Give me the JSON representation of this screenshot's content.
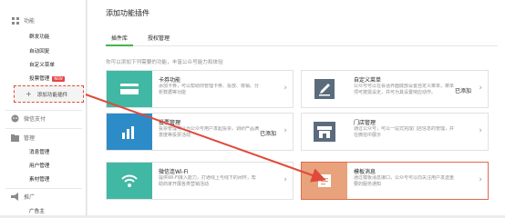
{
  "sidebar": {
    "sections": [
      {
        "label": "功能",
        "icon": "grid-icon"
      },
      {
        "label": "微信支付",
        "icon": "wechat-pay-icon"
      },
      {
        "label": "管理",
        "icon": "folder-icon"
      },
      {
        "label": "推广",
        "icon": "promote-icon"
      }
    ],
    "function_items": [
      "群发功能",
      "自动回复",
      "自定义菜单",
      "投票管理"
    ],
    "new_badge": "NEW",
    "add_plugin_label": "添加功能插件",
    "manage_items": [
      "消息管理",
      "用户管理",
      "素材管理"
    ],
    "promote_items": [
      "广告主"
    ]
  },
  "main": {
    "title": "添加功能插件",
    "tabs": [
      {
        "label": "插件库"
      },
      {
        "label": "授权管理"
      }
    ],
    "intro": "你可以添加下列需要的功能，丰富公众号能力和体验",
    "cards": [
      {
        "title": "卡券功能",
        "desc": "添加卡券，可以帮助你管理卡券、投放、核销、分析数据等功能",
        "status": "",
        "color": "#41b8a4",
        "icon": "card-coupon-icon"
      },
      {
        "title": "自定义菜单",
        "desc": "公众号可以在会话界面底部设置自定义菜单，菜单项可按需设定，并可为其设置响应动作。",
        "status": "已添加",
        "color": "#ffffff",
        "icon": "edit-pen-icon"
      },
      {
        "title": "投票管理",
        "desc": "投票管理可以为公众号用户发起投票，调研产品满意度等投票活动",
        "status": "已添加",
        "color": "#2d8cc8",
        "icon": "bar-chart-icon"
      },
      {
        "title": "门店管理",
        "desc": "通过公众号，可以一站式完成门店信息的管理，并在微信中展示",
        "status": "",
        "color": "#ffffff",
        "icon": "store-icon"
      },
      {
        "title": "微信连Wi-Fi",
        "desc": "提供Wi-Fi接入能力，打通线上与线下的闭环，帮助商家开展各类营销活动",
        "status": "",
        "color": "#41b8a4",
        "icon": "wifi-icon"
      },
      {
        "title": "模板消息",
        "desc": "通过模板消息接口，公众号可以向关注用户发送重要的服务通知",
        "status": "",
        "color": "#e8a37c",
        "icon": "template-doc-icon"
      }
    ]
  },
  "colors": {
    "accent_green": "#44b549",
    "annotation_red": "#e04a3a"
  }
}
